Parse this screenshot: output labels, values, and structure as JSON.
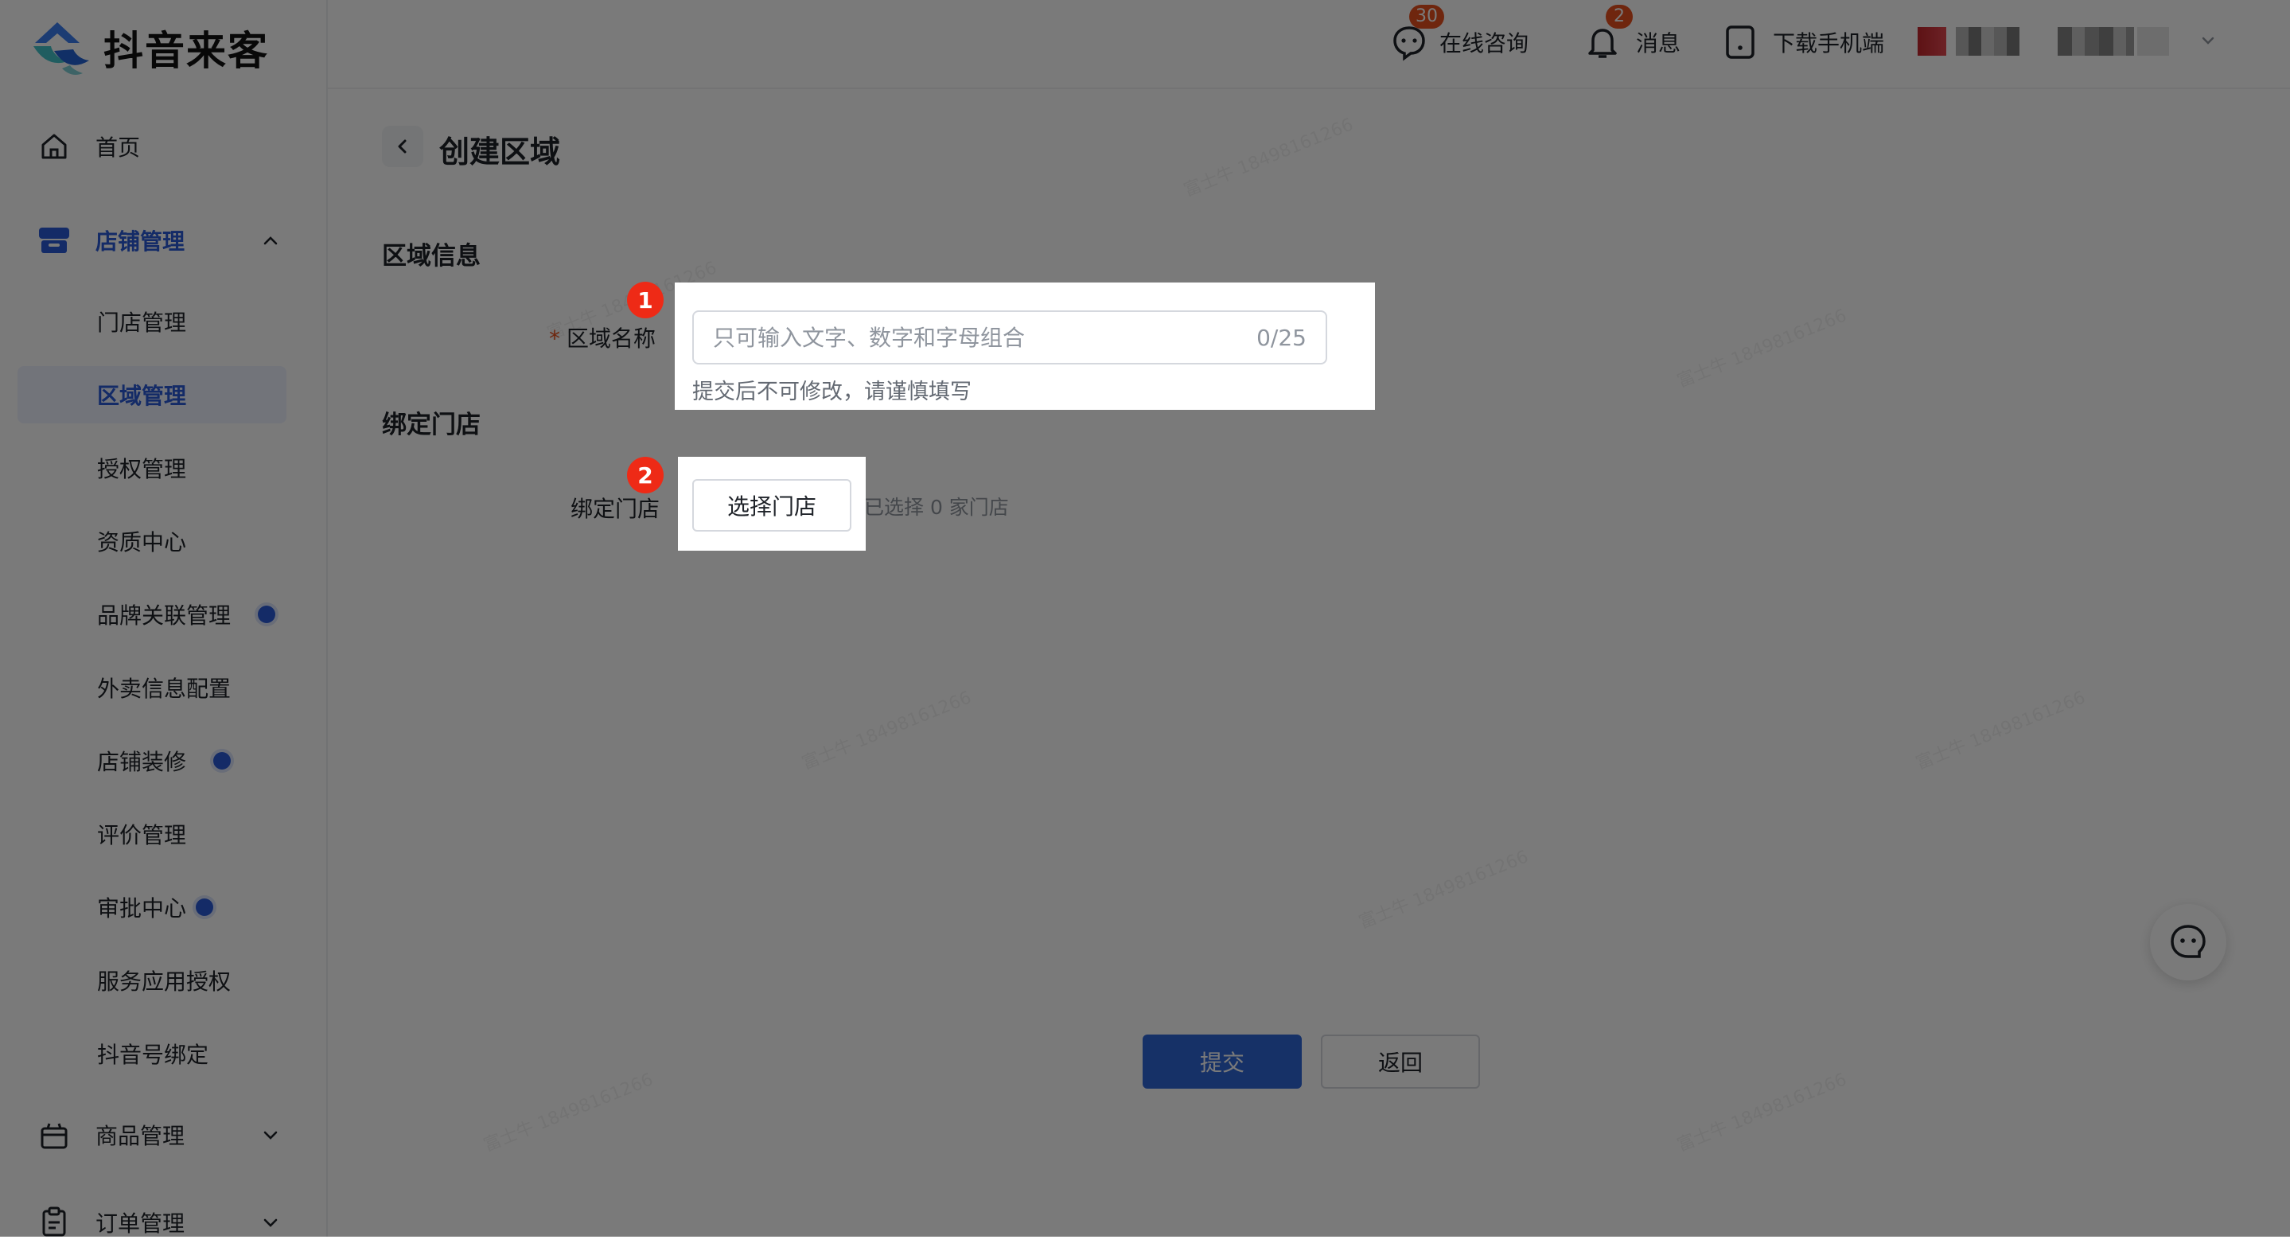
{
  "app": {
    "name": "抖音来客"
  },
  "header": {
    "consult_label": "在线咨询",
    "consult_badge": "30",
    "message_label": "消息",
    "message_badge": "2",
    "download_label": "下载手机端"
  },
  "sidebar": {
    "items": [
      {
        "label": "首页",
        "icon": "home-icon"
      },
      {
        "label": "店铺管理",
        "icon": "store-icon",
        "expanded": true
      }
    ],
    "sub_items": [
      {
        "label": "门店管理"
      },
      {
        "label": "区域管理",
        "selected": true
      },
      {
        "label": "授权管理"
      },
      {
        "label": "资质中心"
      },
      {
        "label": "品牌关联管理",
        "dot": true
      },
      {
        "label": "外卖信息配置"
      },
      {
        "label": "店铺装修",
        "dot": true
      },
      {
        "label": "评价管理"
      },
      {
        "label": "审批中心",
        "dot": true
      },
      {
        "label": "服务应用授权"
      },
      {
        "label": "抖音号绑定"
      }
    ],
    "bottom_items": [
      {
        "label": "商品管理",
        "icon": "goods-icon"
      },
      {
        "label": "订单管理",
        "icon": "order-icon"
      }
    ]
  },
  "page": {
    "title": "创建区域",
    "section_info": "区域信息",
    "section_bind": "绑定门店",
    "area_name_label": "区域名称",
    "required_mark": "*",
    "area_name_value": "",
    "area_name_placeholder": "只可输入文字、数字和字母组合",
    "area_name_counter": "0/25",
    "area_name_hint": "提交后不可修改，请谨慎填写",
    "bind_label": "绑定门店",
    "select_store_button": "选择门店",
    "selected_count_text": "已选择 0 家门店",
    "submit_button": "提交",
    "return_button": "返回"
  },
  "markers": [
    "1",
    "2"
  ],
  "colors": {
    "primary": "#2f66d8",
    "active": "#2a5bd7",
    "badge": "#e8501e",
    "marker": "#ee2a16"
  }
}
